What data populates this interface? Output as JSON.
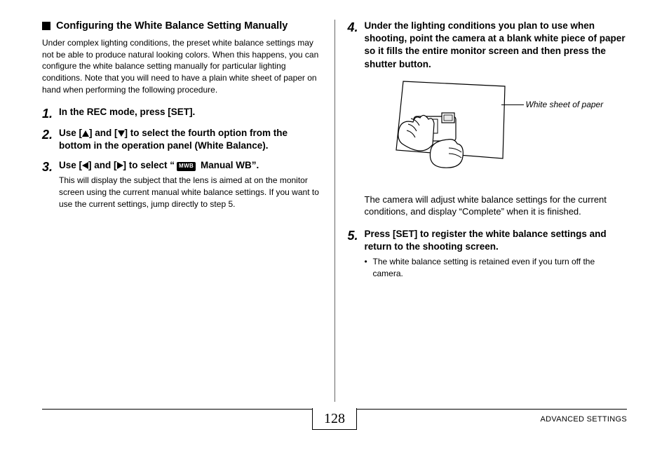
{
  "left": {
    "section_title": "Configuring the White Balance Setting Manually",
    "intro": "Under complex lighting conditions, the preset white balance settings may not be able to produce natural looking colors. When this happens, you can configure the white balance setting manually for particular lighting conditions. Note that you will need to have a plain white sheet of paper on hand when performing the following procedure.",
    "step1_num": "1.",
    "step1_head": "In the REC mode, press [SET].",
    "step2_num": "2.",
    "step2_head_a": "Use [",
    "step2_head_b": "] and [",
    "step2_head_c": "] to select the fourth option from the bottom in the operation panel (White Balance).",
    "step3_num": "3.",
    "step3_head_a": "Use [",
    "step3_head_b": "] and [",
    "step3_head_c": "] to select “",
    "step3_head_d": " Manual WB”.",
    "step3_icon": "MWB",
    "step3_sub": "This will display the subject that the lens is aimed at on the monitor screen using the current manual white balance settings. If you want to use the current settings, jump directly to step 5."
  },
  "right": {
    "step4_num": "4.",
    "step4_head": "Under the lighting conditions you plan to use when shooting, point the camera at a blank white piece of paper so it fills the entire monitor screen and then press the shutter button.",
    "fig_label": "White sheet of paper",
    "step4_sub": "The camera will adjust white balance settings for the current conditions, and display “Complete” when it is finished.",
    "step5_num": "5.",
    "step5_head": "Press [SET] to register the white balance settings and return to the shooting screen.",
    "step5_bullet": "The white balance setting is retained even if you turn off the camera."
  },
  "footer": {
    "page": "128",
    "section": "ADVANCED SETTINGS"
  }
}
